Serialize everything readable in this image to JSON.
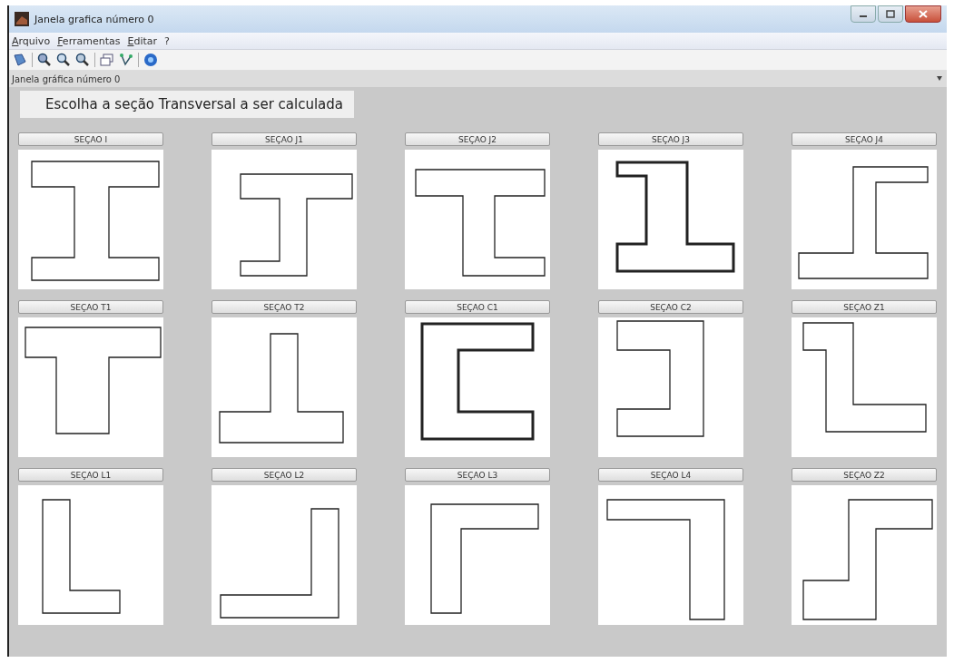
{
  "window": {
    "title": "Janela grafica número 0"
  },
  "menu": [
    "Arquivo",
    "Ferramentas",
    "Editar",
    "?"
  ],
  "panel": {
    "title": "Janela gráfica número 0"
  },
  "heading": "Escolha a seção Transversal a ser calculada",
  "sections": [
    {
      "label": "SEÇAO I",
      "kind": "I",
      "bold": false
    },
    {
      "label": "SEÇAO J1",
      "kind": "J1",
      "bold": false
    },
    {
      "label": "SEÇAO J2",
      "kind": "J2",
      "bold": false
    },
    {
      "label": "SEÇAO J3",
      "kind": "J3",
      "bold": true
    },
    {
      "label": "SEÇAO J4",
      "kind": "J4",
      "bold": false
    },
    {
      "label": "SEÇAO T1",
      "kind": "T1",
      "bold": false
    },
    {
      "label": "SEÇAO T2",
      "kind": "T2",
      "bold": false
    },
    {
      "label": "SEÇAO C1",
      "kind": "C1",
      "bold": true
    },
    {
      "label": "SEÇAO C2",
      "kind": "C2",
      "bold": false
    },
    {
      "label": "SEÇAO Z1",
      "kind": "Z1",
      "bold": false
    },
    {
      "label": "SEÇAO L1",
      "kind": "L1",
      "bold": false
    },
    {
      "label": "SEÇAO L2",
      "kind": "L2",
      "bold": false
    },
    {
      "label": "SEÇAO L3",
      "kind": "L3",
      "bold": false
    },
    {
      "label": "SEÇAO L4",
      "kind": "L4",
      "bold": false
    },
    {
      "label": "SEÇAO Z2",
      "kind": "Z2",
      "bold": false
    }
  ]
}
